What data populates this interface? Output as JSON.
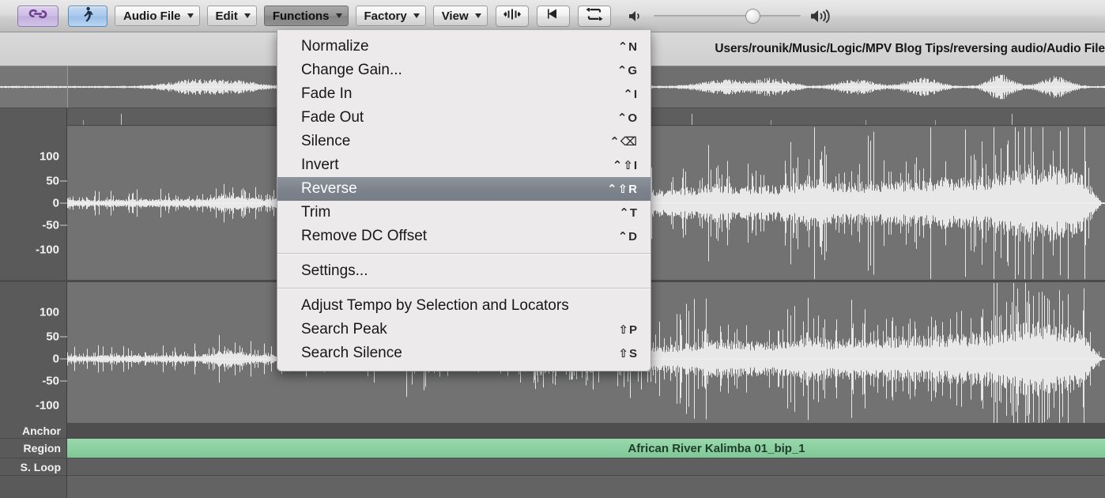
{
  "toolbar": {
    "link_button": {
      "name": "link-toggle",
      "icon": "chain-link-icon"
    },
    "walk_button": {
      "name": "prelisten-toggle",
      "icon": "walking-person-icon"
    },
    "menus": [
      {
        "label": "Audio File",
        "active": false
      },
      {
        "label": "Edit",
        "active": false
      },
      {
        "label": "Functions",
        "active": true
      },
      {
        "label": "Factory",
        "active": false
      },
      {
        "label": "View",
        "active": false
      }
    ],
    "icon_buttons": [
      {
        "name": "waveform-zoom-button",
        "icon": "waveform-zoom-icon"
      },
      {
        "name": "play-button",
        "icon": "play-left-icon"
      },
      {
        "name": "cycle-button",
        "icon": "loop-cycle-icon"
      }
    ],
    "volume": {
      "min_icon": "speaker-low-icon",
      "max_icon": "speaker-high-icon",
      "value_percent": 62
    }
  },
  "path_bar": {
    "path": "Users/rounik/Music/Logic/MPV Blog Tips/reversing audio/Audio File"
  },
  "menu": {
    "title": "Functions",
    "groups": [
      {
        "items": [
          {
            "label": "Normalize",
            "shortcut": "⌃N",
            "selected": false
          },
          {
            "label": "Change Gain...",
            "shortcut": "⌃G",
            "selected": false
          },
          {
            "label": "Fade In",
            "shortcut": "⌃I",
            "selected": false
          },
          {
            "label": "Fade Out",
            "shortcut": "⌃O",
            "selected": false
          },
          {
            "label": "Silence",
            "shortcut": "⌃⌫",
            "selected": false
          },
          {
            "label": "Invert",
            "shortcut": "⌃⇧I",
            "selected": false
          },
          {
            "label": "Reverse",
            "shortcut": "⌃⇧R",
            "selected": true
          },
          {
            "label": "Trim",
            "shortcut": "⌃T",
            "selected": false
          },
          {
            "label": "Remove DC Offset",
            "shortcut": "⌃D",
            "selected": false
          }
        ]
      },
      {
        "items": [
          {
            "label": "Settings...",
            "shortcut": "",
            "selected": false
          }
        ]
      },
      {
        "items": [
          {
            "label": "Adjust Tempo by Selection and Locators",
            "shortcut": "",
            "selected": false
          },
          {
            "label": "Search Peak",
            "shortcut": "⇧P",
            "selected": false
          },
          {
            "label": "Search Silence",
            "shortcut": "⇧S",
            "selected": false
          }
        ]
      }
    ]
  },
  "editor": {
    "channels": [
      {
        "name": "channel-1",
        "axis_labels": [
          "100",
          "50",
          "0",
          "-50",
          "-100"
        ]
      },
      {
        "name": "channel-2",
        "axis_labels": [
          "100",
          "50",
          "0",
          "-50",
          "-100"
        ]
      }
    ],
    "lanes": [
      {
        "label": "Anchor",
        "kind": "anchor"
      },
      {
        "label": "Region",
        "kind": "region",
        "region_name": "African River Kalimba 01_bip_1"
      },
      {
        "label": "S. Loop",
        "kind": "sloop"
      }
    ]
  },
  "colors": {
    "region_green": "#8ccfa1",
    "menu_highlight": "#7d848d",
    "waveform": "#e8e8e8",
    "editor_bg": "#727272",
    "gutter_bg": "#5a5a5a"
  }
}
